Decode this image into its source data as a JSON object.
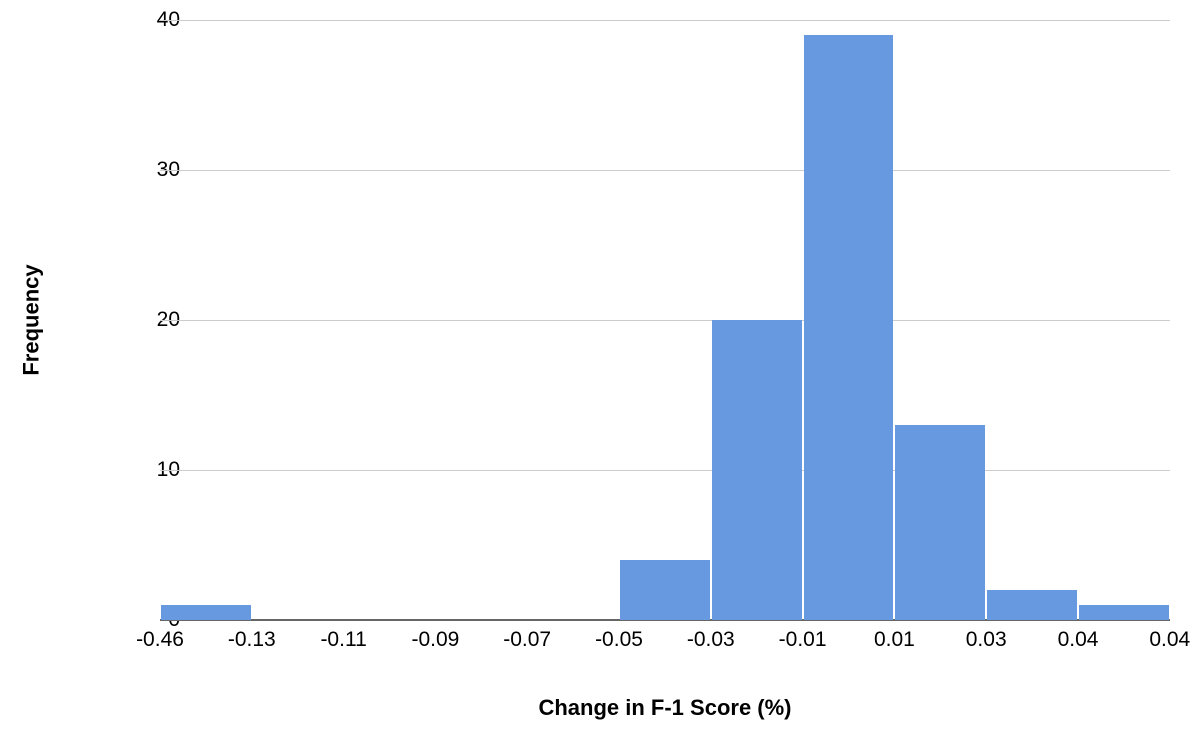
{
  "chart_data": {
    "type": "bar",
    "title": "",
    "xlabel": "Change in F-1 Score (%)",
    "ylabel": "Frequency",
    "ylim": [
      0,
      40
    ],
    "y_ticks": [
      0,
      10,
      20,
      30,
      40
    ],
    "categories_edges": [
      "-0.46",
      "-0.13",
      "-0.11",
      "-0.09",
      "-0.07",
      "-0.05",
      "-0.03",
      "-0.01",
      "0.01",
      "0.03",
      "0.04",
      "0.04"
    ],
    "values": [
      1,
      0,
      0,
      0,
      0,
      4,
      20,
      39,
      13,
      2,
      1
    ],
    "bar_color": "#6699e0",
    "grid_color": "#cccccc"
  }
}
